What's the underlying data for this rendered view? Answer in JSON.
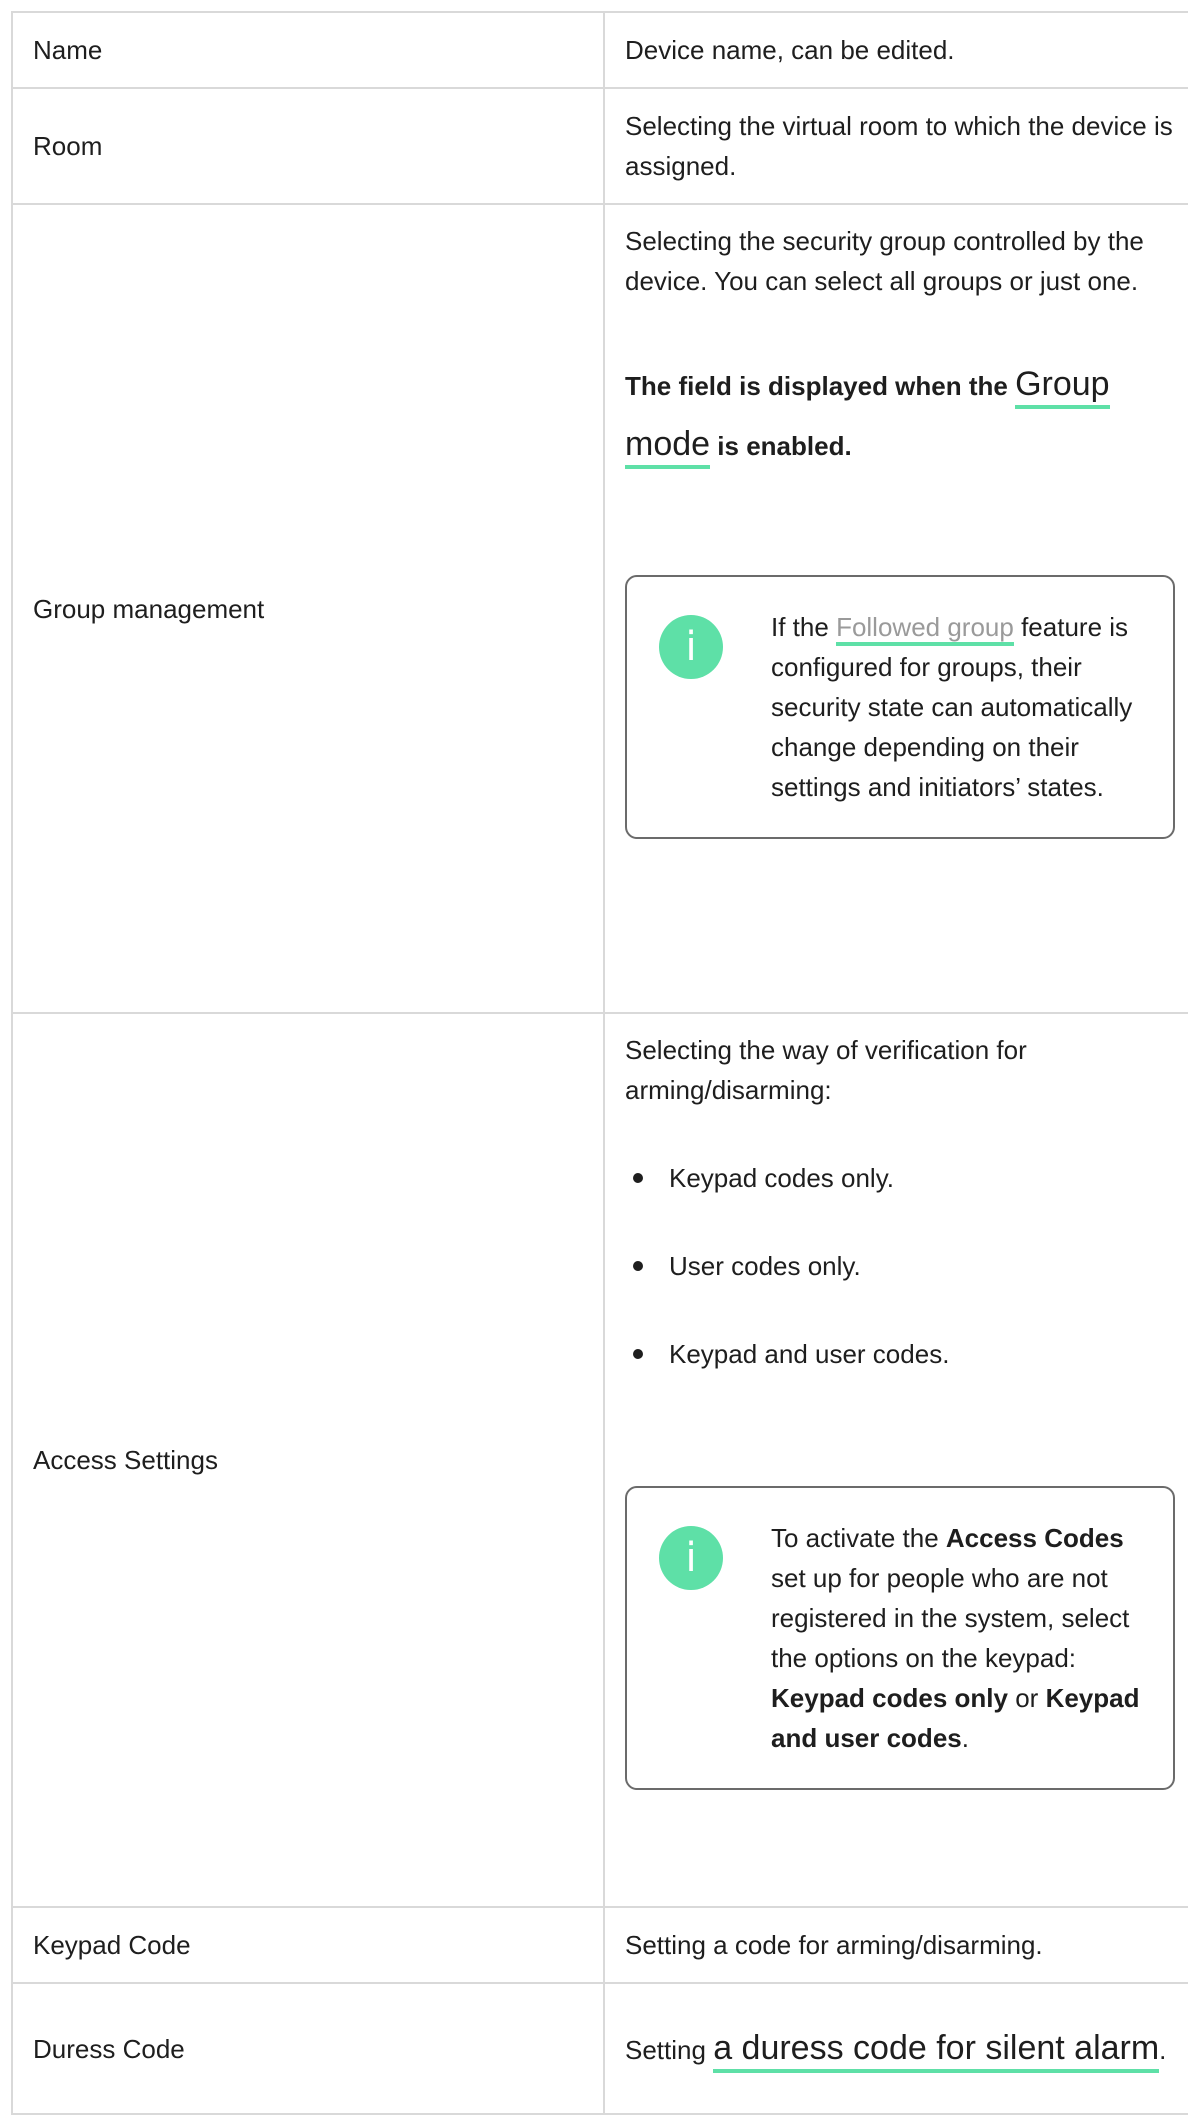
{
  "rows": [
    {
      "label": "Name",
      "description": "Device name, can be edited."
    },
    {
      "label": "Room",
      "description": "Selecting the virtual room to which the device is assigned."
    },
    {
      "label": "Group management",
      "description": "Selecting the security group controlled by the device. You can select all groups or just one.",
      "bold_prefix": "The field is displayed when the",
      "bold_link": "Group mode",
      "bold_suffix": "is enabled.",
      "note": {
        "text_before": "If the",
        "link": "Followed group",
        "text_after": "feature is configured for groups, their security state can automatically change depending on their settings and initiators’ states."
      }
    },
    {
      "label": "Access Settings",
      "description": "Selecting the way of verification for arming/disarming:",
      "options": [
        "Keypad codes only.",
        "User codes only.",
        "Keypad and user codes."
      ],
      "note": {
        "t1": "To activate the",
        "b1": "Access Codes",
        "t2": "set up for people who are not registered in the system, select the options on the keypad:",
        "b2": "Keypad codes only",
        "t3": "or",
        "b3": "Keypad and user codes",
        "t4": "."
      }
    },
    {
      "label": "Keypad Code",
      "description": "Setting a code for arming/disarming."
    },
    {
      "label": "Duress Code",
      "prefix": "Setting",
      "link": "a duress code for silent alarm",
      "suffix": "."
    }
  ],
  "colors": {
    "accent": "#5ee0a7",
    "border": "#d9d9d9",
    "text": "#1e1e1e",
    "link_grey": "#9a9a9a"
  },
  "icons": [
    "info-icon"
  ]
}
